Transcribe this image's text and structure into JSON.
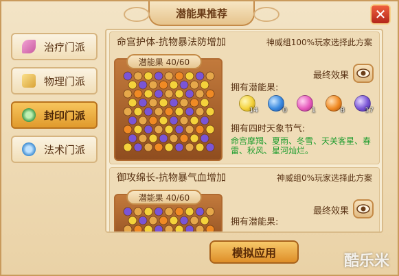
{
  "window": {
    "title": "潜能果推荐",
    "close_glyph": "✕"
  },
  "sidebar": {
    "tabs": [
      {
        "label": "治疗门派",
        "active": false,
        "icon": "feather-icon",
        "color": "#c85aa0"
      },
      {
        "label": "物理门派",
        "active": false,
        "icon": "fist-icon",
        "color": "#d9a338"
      },
      {
        "label": "封印门派",
        "active": true,
        "icon": "seal-icon",
        "color": "#3f9a4a"
      },
      {
        "label": "法术门派",
        "active": false,
        "icon": "magic-icon",
        "color": "#3a8ad1"
      }
    ]
  },
  "schemes": [
    {
      "name": "命宫护体-抗物暴法防增加",
      "note": "神威组100%玩家选择此方案",
      "board_label": "潜能果 40/60",
      "final_effect_label": "最终效果",
      "owned_label": "拥有潜能果:",
      "orbs": [
        {
          "count": "14",
          "color": "#f4d23b",
          "icon": "lightning-orb-icon"
        },
        {
          "count": "0",
          "color": "#3b8ae0",
          "icon": "water-orb-icon"
        },
        {
          "count": "1",
          "color": "#e75bbd",
          "icon": "spiral-orb-icon"
        },
        {
          "count": "8",
          "color": "#f08a24",
          "icon": "fire-orb-icon"
        },
        {
          "count": "17",
          "color": "#7a55d6",
          "icon": "purple-orb-icon"
        }
      ],
      "terms_label": "拥有四时天象节气:",
      "terms_lines": [
        "命宫摩羯、夏雨、冬雪、天关客星、春",
        "雷、秋风、星河灿烂。"
      ]
    },
    {
      "name": "御攻绵长-抗物暴气血增加",
      "note": "神威组0%玩家选择此方案",
      "board_label": "潜能果 40/60",
      "final_effect_label": "最终效果",
      "owned_label": "拥有潜能果:"
    }
  ],
  "actions": {
    "apply_label": "模拟应用"
  },
  "watermark": "酷乐米"
}
